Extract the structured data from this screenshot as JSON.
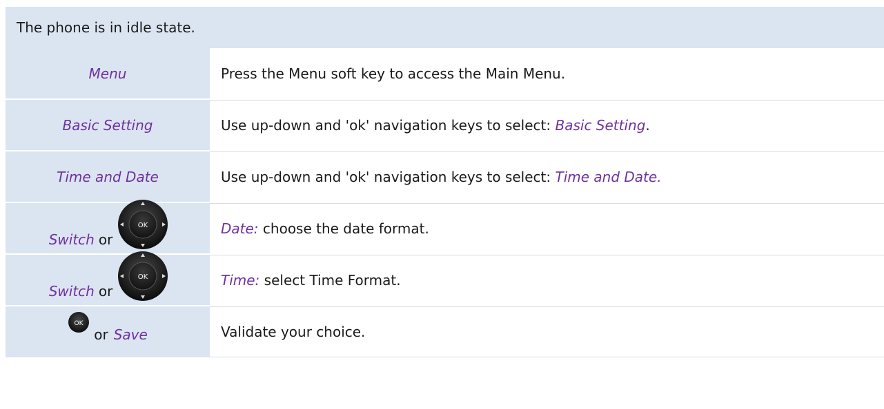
{
  "header": {
    "text": "The phone is in idle state."
  },
  "rows": [
    {
      "left": "Menu",
      "right": "Press the Menu soft key to access the Main Menu."
    },
    {
      "left": "Basic Setting",
      "right_prefix": "Use up-down and 'ok' navigation keys to select: ",
      "right_em": "Basic Setting",
      "right_suffix": "."
    },
    {
      "left": "Time and Date",
      "right_prefix": "Use up-down and 'ok' navigation keys to select: ",
      "right_em": "Time and Date."
    },
    {
      "left_em": "Switch",
      "left_or": "or",
      "key_label": "OK",
      "right_em": "Date:",
      "right_rest": " choose the date format."
    },
    {
      "left_em": "Switch",
      "left_or": "or",
      "key_label": "OK",
      "right_em": "Time:",
      "right_rest": " select Time Format."
    },
    {
      "key_label": "OK",
      "left_or": "or",
      "left_em": "Save",
      "right": "Validate your choice."
    }
  ],
  "colors": {
    "band": "#dbe5f1",
    "accent": "#7030a0"
  },
  "icons": {
    "nav_pad": "navigation-pad-icon",
    "ok_key": "ok-key-icon"
  }
}
